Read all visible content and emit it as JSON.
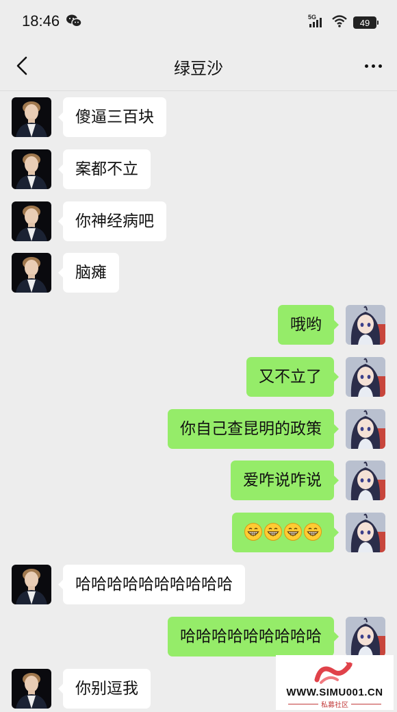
{
  "status_bar": {
    "time": "18:46",
    "network": "5G",
    "battery": "49"
  },
  "header": {
    "title": "绿豆沙"
  },
  "messages": [
    {
      "side": "left",
      "text": "傻逼三百块"
    },
    {
      "side": "left",
      "text": "案都不立"
    },
    {
      "side": "left",
      "text": "你神经病吧"
    },
    {
      "side": "left",
      "text": "脑瘫"
    },
    {
      "side": "right",
      "text": "哦哟"
    },
    {
      "side": "right",
      "text": "又不立了"
    },
    {
      "side": "right",
      "text": "你自己查昆明的政策"
    },
    {
      "side": "right",
      "text": "爱咋说咋说"
    },
    {
      "side": "right",
      "emoji": "grin-emoji",
      "emoji_count": 4
    },
    {
      "side": "left",
      "text": "哈哈哈哈哈哈哈哈哈哈"
    },
    {
      "side": "right",
      "text": "哈哈哈哈哈哈哈哈哈"
    },
    {
      "side": "left",
      "text": "你别逗我"
    }
  ],
  "watermark": {
    "url": "WWW.SIMU001.CN",
    "subtitle": "私募社区"
  },
  "colors": {
    "background": "#ededed",
    "sent_bubble": "#95ec69",
    "received_bubble": "#ffffff"
  }
}
